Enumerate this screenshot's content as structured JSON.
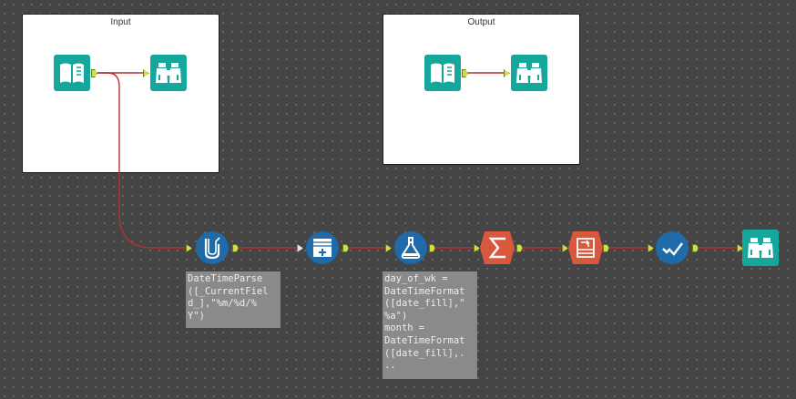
{
  "containers": {
    "input": {
      "title": "Input"
    },
    "output": {
      "title": "Output"
    }
  },
  "tools": [
    {
      "id": "input-data-1",
      "icon": "book-input-icon",
      "color": "#16a79c"
    },
    {
      "id": "browse-1",
      "icon": "binoculars-icon",
      "color": "#16a79c"
    },
    {
      "id": "input-data-2",
      "icon": "book-input-icon",
      "color": "#16a79c"
    },
    {
      "id": "browse-2",
      "icon": "binoculars-icon",
      "color": "#16a79c"
    },
    {
      "id": "multi-field-formula",
      "icon": "flask-pipe-icon",
      "color": "#1f6aa8"
    },
    {
      "id": "select-records",
      "icon": "table-add-icon",
      "color": "#1f6aa8"
    },
    {
      "id": "formula",
      "icon": "flask-icon",
      "color": "#1f6aa8"
    },
    {
      "id": "summarize",
      "icon": "sigma-icon",
      "color": "#d9573c"
    },
    {
      "id": "cross-tab",
      "icon": "crosstab-icon",
      "color": "#d9573c"
    },
    {
      "id": "test",
      "icon": "check-icon",
      "color": "#1f6aa8"
    },
    {
      "id": "browse-3",
      "icon": "binoculars-icon",
      "color": "#16a79c"
    }
  ],
  "annotations": {
    "multi_field_formula": "DateTimeParse\n([_CurrentFiel\nd_],\"%m/%d/%\nY\")",
    "formula": "day_of_wk =\nDateTimeFormat\n([date_fill],\"\n%a\")\nmonth =\nDateTimeFormat\n([date_fill],.\n.."
  },
  "colors": {
    "canvas": "#454545",
    "wire": "#c0392b",
    "anchor": "#c8e04a",
    "teal": "#16a79c",
    "blue": "#1f6aa8",
    "orange": "#d9573c"
  }
}
